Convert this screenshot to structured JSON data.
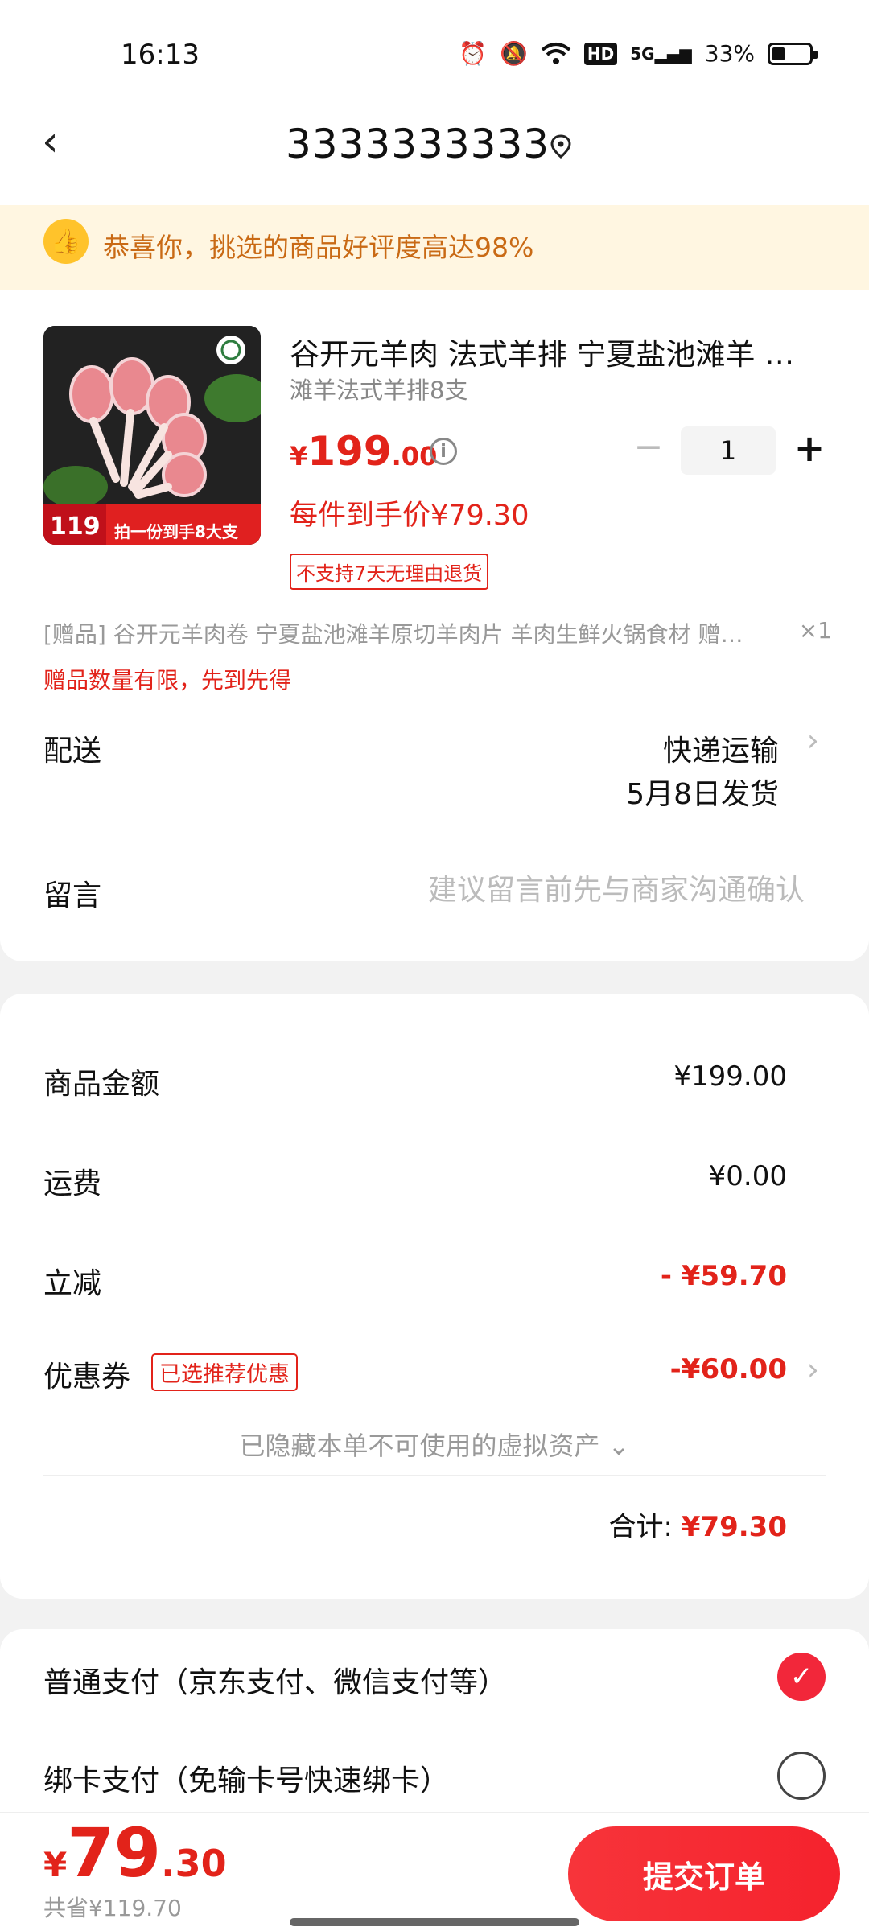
{
  "status_bar": {
    "time": "16:13",
    "network": "5G",
    "battery": "33%",
    "battery_level": 0.33
  },
  "header": {
    "title": "3333333333"
  },
  "banner": {
    "text": "恭喜你，挑选的商品好评度高达98%"
  },
  "product": {
    "image_alt": "谷开元 法式羊排",
    "title": "谷开元羊肉 法式羊排 宁夏盐池滩羊 …",
    "spec": "滩羊法式羊排8支",
    "price_symbol": "¥",
    "price_int": "199",
    "price_dec": ".00",
    "quantity": "1",
    "per_item_price": "每件到手价¥79.30",
    "return_policy": "不支持7天无理由退货",
    "image_badge_price": "119",
    "image_badge_text": "拍一份到手8大支"
  },
  "gift": {
    "text": "[赠品]  谷开元羊肉卷 宁夏盐池滩羊原切羊肉片 羊肉生鲜火锅食材 赠…",
    "qty": "×1",
    "limit_note": "赠品数量有限，先到先得"
  },
  "delivery": {
    "label": "配送",
    "method": "快递运输",
    "date": "5月8日发货"
  },
  "message": {
    "label": "留言",
    "placeholder": "建议留言前先与商家沟通确认"
  },
  "summary": {
    "goods_label": "商品金额",
    "goods_value": "¥199.00",
    "shipping_label": "运费",
    "shipping_value": "¥0.00",
    "discount_label": "立减",
    "discount_value": "- ¥59.70",
    "coupon_label": "优惠券",
    "coupon_tag": "已选推荐优惠",
    "coupon_value": "-¥60.00",
    "hidden_assets": "已隐藏本单不可使用的虚拟资产 ⌄",
    "total_label": "合计:",
    "total_value": "¥79.30"
  },
  "payment": {
    "option1": "普通支付（京东支付、微信支付等）",
    "option2": "绑卡支付（免输卡号快速绑卡）"
  },
  "bottom": {
    "price_symbol": "¥",
    "price_int": "79",
    "price_dec": ".30",
    "saved": "共省¥119.70",
    "submit_label": "提交订单"
  }
}
